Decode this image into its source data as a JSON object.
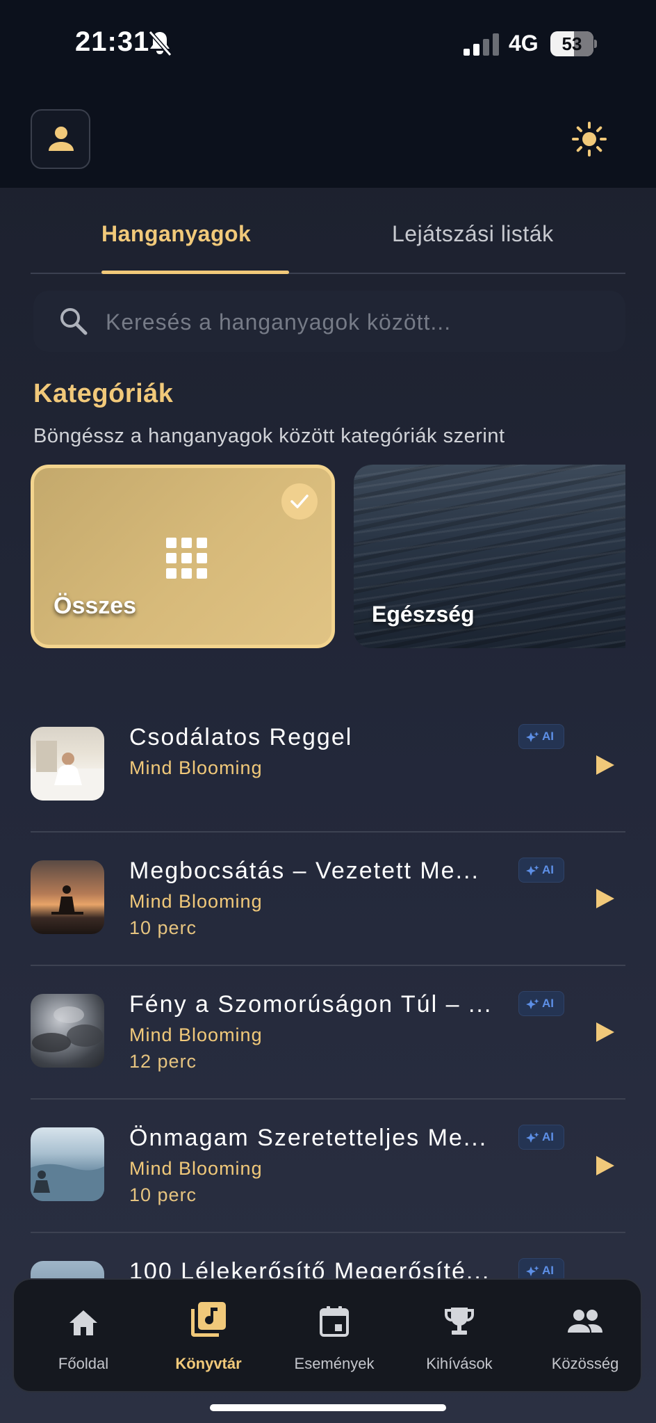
{
  "status_bar": {
    "time": "21:31",
    "network": "4G",
    "battery": "53",
    "battery_level": 0.53,
    "signal_bars": 2
  },
  "header": {
    "profile_icon": "person-icon",
    "theme_icon": "sun-icon"
  },
  "tabs": [
    {
      "label": "Hanganyagok",
      "active": true
    },
    {
      "label": "Lejátszási listák",
      "active": false
    }
  ],
  "search": {
    "placeholder": "Keresés a hanganyagok között...",
    "value": ""
  },
  "categories": {
    "title": "Kategóriák",
    "subtitle": "Böngéssz a hanganyagok között kategóriák szerint",
    "items": [
      {
        "label": "Összes",
        "selected": true,
        "icon": "grid-icon"
      },
      {
        "label": "Egészség",
        "selected": false
      }
    ]
  },
  "tracks": [
    {
      "title": "Csodálatos Reggel",
      "author": "Mind Blooming",
      "duration": "",
      "badge": "AI"
    },
    {
      "title": "Megbocsátás – Vezetett Me...",
      "author": "Mind Blooming",
      "duration": "10 perc",
      "badge": "AI"
    },
    {
      "title": "Fény a Szomorúságon Túl – ...",
      "author": "Mind Blooming",
      "duration": "12 perc",
      "badge": "AI"
    },
    {
      "title": "Önmagam Szeretetteljes Me...",
      "author": "Mind Blooming",
      "duration": "10 perc",
      "badge": "AI"
    },
    {
      "title": "100 Lélekerősítő Megerősíté...",
      "author": "",
      "duration": "",
      "badge": "AI"
    }
  ],
  "bottom_nav": [
    {
      "label": "Főoldal",
      "icon": "home-icon",
      "active": false
    },
    {
      "label": "Könyvtár",
      "icon": "library-music-icon",
      "active": true
    },
    {
      "label": "Események",
      "icon": "calendar-icon",
      "active": false
    },
    {
      "label": "Kihívások",
      "icon": "trophy-icon",
      "active": false
    },
    {
      "label": "Közösség",
      "icon": "people-icon",
      "active": false
    }
  ],
  "colors": {
    "accent": "#f1c97a",
    "background": "#1b1f2b",
    "ai_badge": "#5d8fe6"
  }
}
